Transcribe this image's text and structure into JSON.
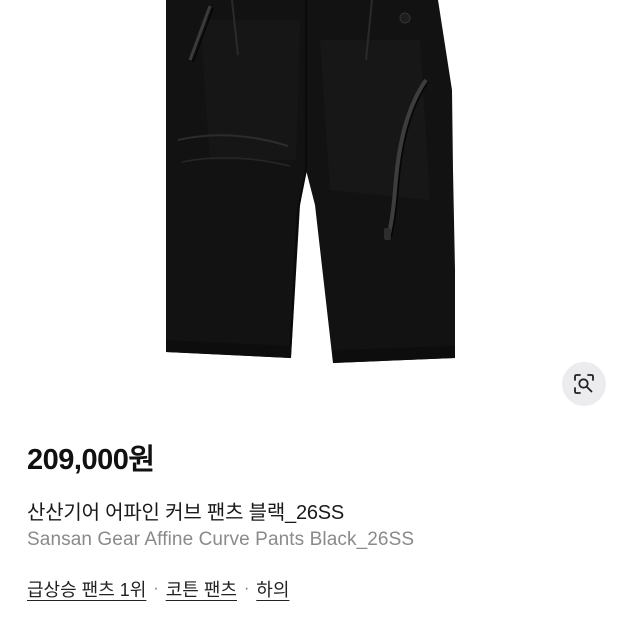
{
  "product": {
    "image_alt": "Black curve pants",
    "price": "209,000원",
    "title_ko": "산산기어 어파인 커브 팬츠 블랙_26SS",
    "title_en": "Sansan Gear Affine Curve Pants Black_26SS"
  },
  "actions": {
    "lens_icon": "visual-search-icon"
  },
  "tags": {
    "items": [
      "급상승 팬츠 1위",
      "코튼 팬츠",
      "하의"
    ],
    "separator": "·"
  },
  "colors": {
    "garment": "#121212",
    "lens_button_bg": "#ececee",
    "secondary_text": "#8a8a8a"
  }
}
